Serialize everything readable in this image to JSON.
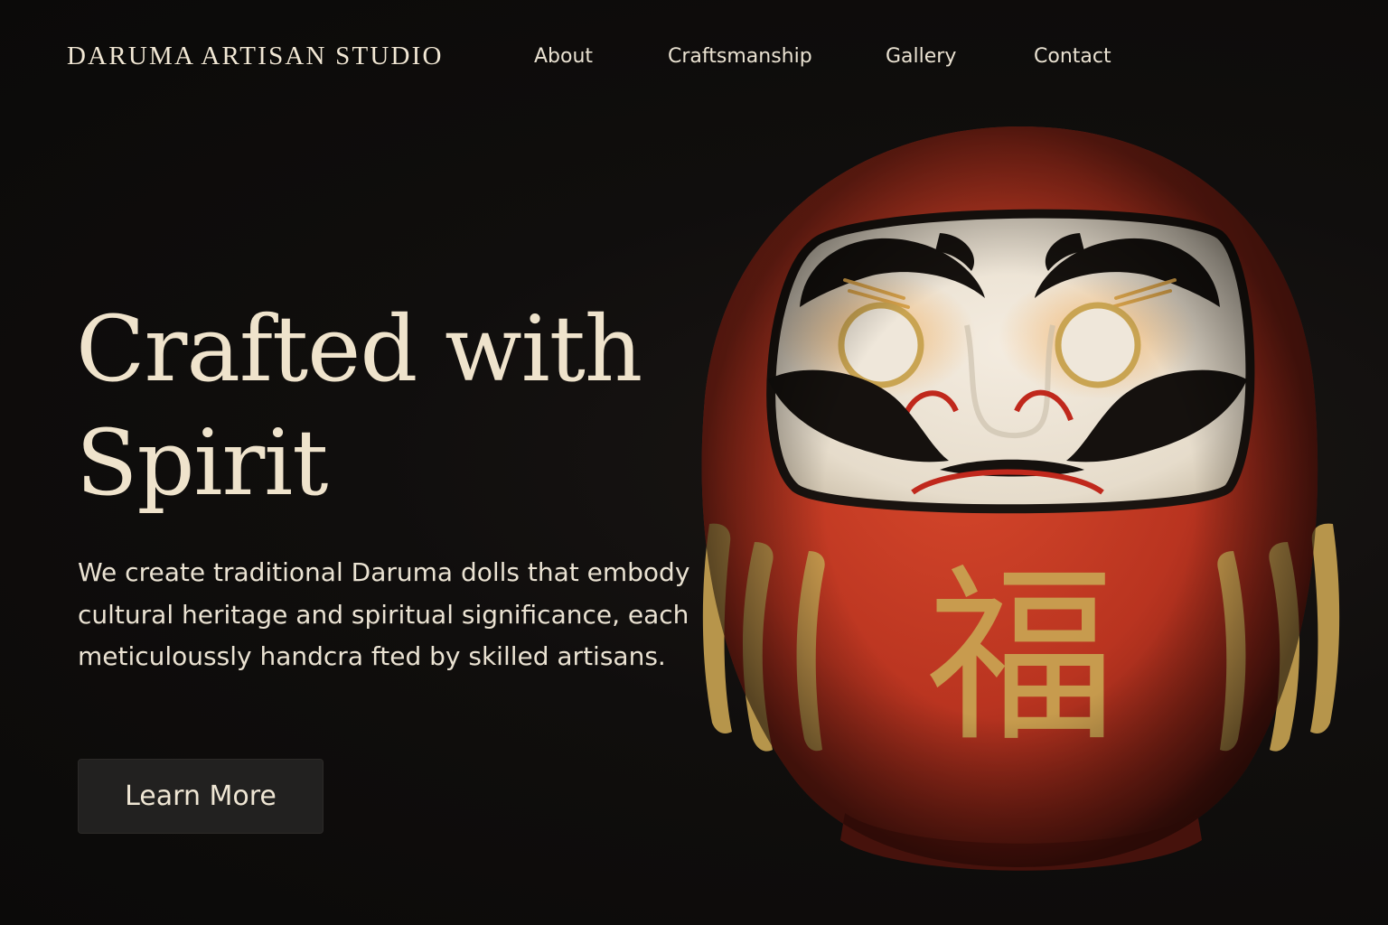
{
  "header": {
    "brand": "DARUMA ARTISAN STUDIO",
    "nav": {
      "about": "About",
      "craftsmanship": "Craftsmanship",
      "gallery": "Gallery",
      "contact": "Contact"
    }
  },
  "hero": {
    "title": "Crafted with Spirit",
    "description": "We create traditional Daruma dolls that embody cultural heritage and spiritual significance, each meticuloussly handcra fted by skilled artisans.",
    "cta_label": "Learn More"
  },
  "image": {
    "subject": "daruma-doll",
    "kanji": "福"
  },
  "colors": {
    "background": "#0d0c0b",
    "text": "#efe3cc",
    "button": "#222120",
    "daruma_red": "#c23a22",
    "gold": "#c9a452"
  }
}
